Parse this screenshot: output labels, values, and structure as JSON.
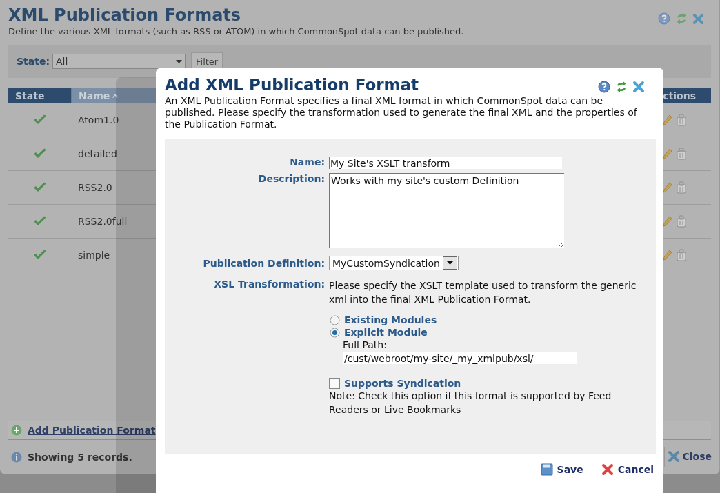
{
  "page": {
    "title": "XML Publication Formats",
    "subtitle": "Define the various XML formats (such as RSS or ATOM) in which CommonSpot data can be published.",
    "filter": {
      "label": "State:",
      "value": "All",
      "button": "Filter"
    },
    "table": {
      "columns": [
        {
          "label": "State",
          "selected": false
        },
        {
          "label": "Name",
          "selected": true
        },
        {
          "label": "ctions",
          "selected": false
        }
      ],
      "rows": [
        {
          "name": "Atom1.0"
        },
        {
          "name": "detailed"
        },
        {
          "name": "RSS2.0"
        },
        {
          "name": "RSS2.0full"
        },
        {
          "name": "simple"
        }
      ]
    },
    "add_link": "Add Publication Format",
    "status": "Showing 5 records.",
    "close_button": "Close"
  },
  "dialog": {
    "title": "Add XML Publication Format",
    "description": "An XML Publication Format specifies a final XML format in which CommonSpot data can be published. Please specify the transformation used to generate the final XML and the properties of the Publication Format.",
    "name": {
      "label": "Name:",
      "value": "My Site's XSLT transform"
    },
    "description_field": {
      "label": "Description:",
      "value": "Works with my site's custom Definition"
    },
    "publication_definition": {
      "label": "Publication Definition:",
      "value": "MyCustomSyndication"
    },
    "xsl": {
      "label": "XSL Transformation:",
      "help": "Please specify the XSLT template used to transform the generic xml into the final XML Publication Format.",
      "options": [
        {
          "label": "Existing Modules",
          "selected": false
        },
        {
          "label": "Explicit Module",
          "selected": true
        }
      ],
      "path_label": "Full Path:",
      "path_value": "/cust/webroot/my-site/_my_xmlpub/xsl/"
    },
    "syndication": {
      "label": "Supports Syndication",
      "checked": false,
      "note": "Note: Check this option if this format is supported by Feed Readers or Live Bookmarks"
    },
    "buttons": [
      {
        "label": "Save",
        "kind": "save"
      },
      {
        "label": "Cancel",
        "kind": "cancel"
      }
    ]
  }
}
